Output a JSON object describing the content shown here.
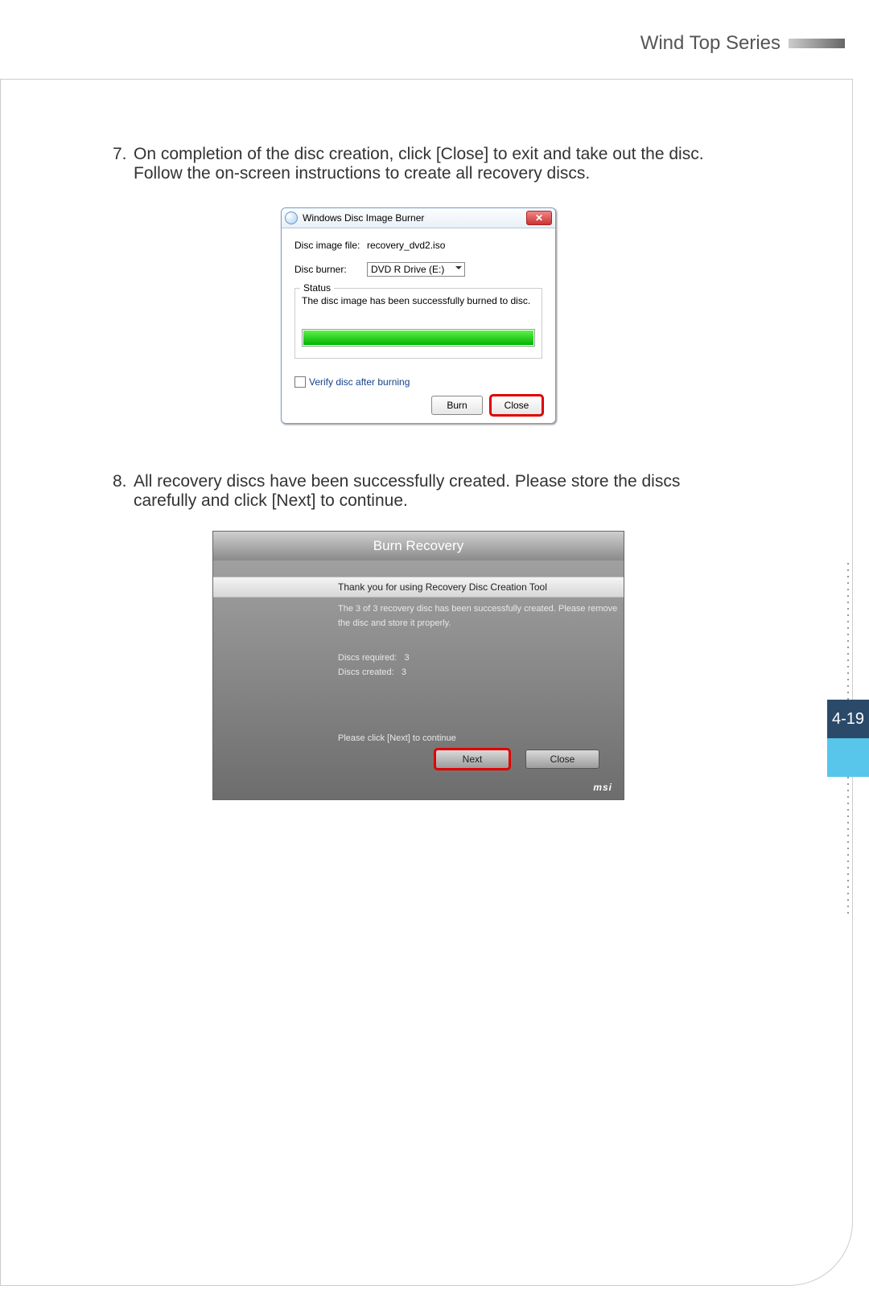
{
  "header": {
    "series": "Wind Top Series"
  },
  "page_tab": {
    "label": "4-19"
  },
  "steps": [
    {
      "num": "7.",
      "text_line1": "On completion of the disc creation, click [Close] to exit and take out the disc.",
      "text_line2": "Follow the on-screen instructions to create all recovery discs."
    },
    {
      "num": "8.",
      "text_line1": "All recovery discs have been successfully created. Please store the discs",
      "text_line2": "carefully and click [Next] to continue."
    }
  ],
  "win": {
    "title": "Windows Disc Image Burner",
    "close_glyph": "✕",
    "file_label": "Disc image file:",
    "file_value": "recovery_dvd2.iso",
    "burner_label": "Disc burner:",
    "burner_value": "DVD R Drive (E:)",
    "status_label": "Status",
    "status_text": "The disc image has been successfully burned to disc.",
    "verify_label": "Verify disc after burning",
    "burn_btn": "Burn",
    "close_btn": "Close"
  },
  "msi": {
    "title": "Burn Recovery",
    "banner": "Thank you for using Recovery Disc Creation Tool",
    "body_line1": "The 3 of 3 recovery disc has been successfully created. Please remove",
    "body_line2": "the disc and store it properly.",
    "req_label": "Discs required:",
    "req_val": "3",
    "created_label": "Discs created:",
    "created_val": "3",
    "footer_text": "Please click [Next] to continue",
    "next_btn": "Next",
    "close_btn": "Close",
    "brand": "msi"
  }
}
